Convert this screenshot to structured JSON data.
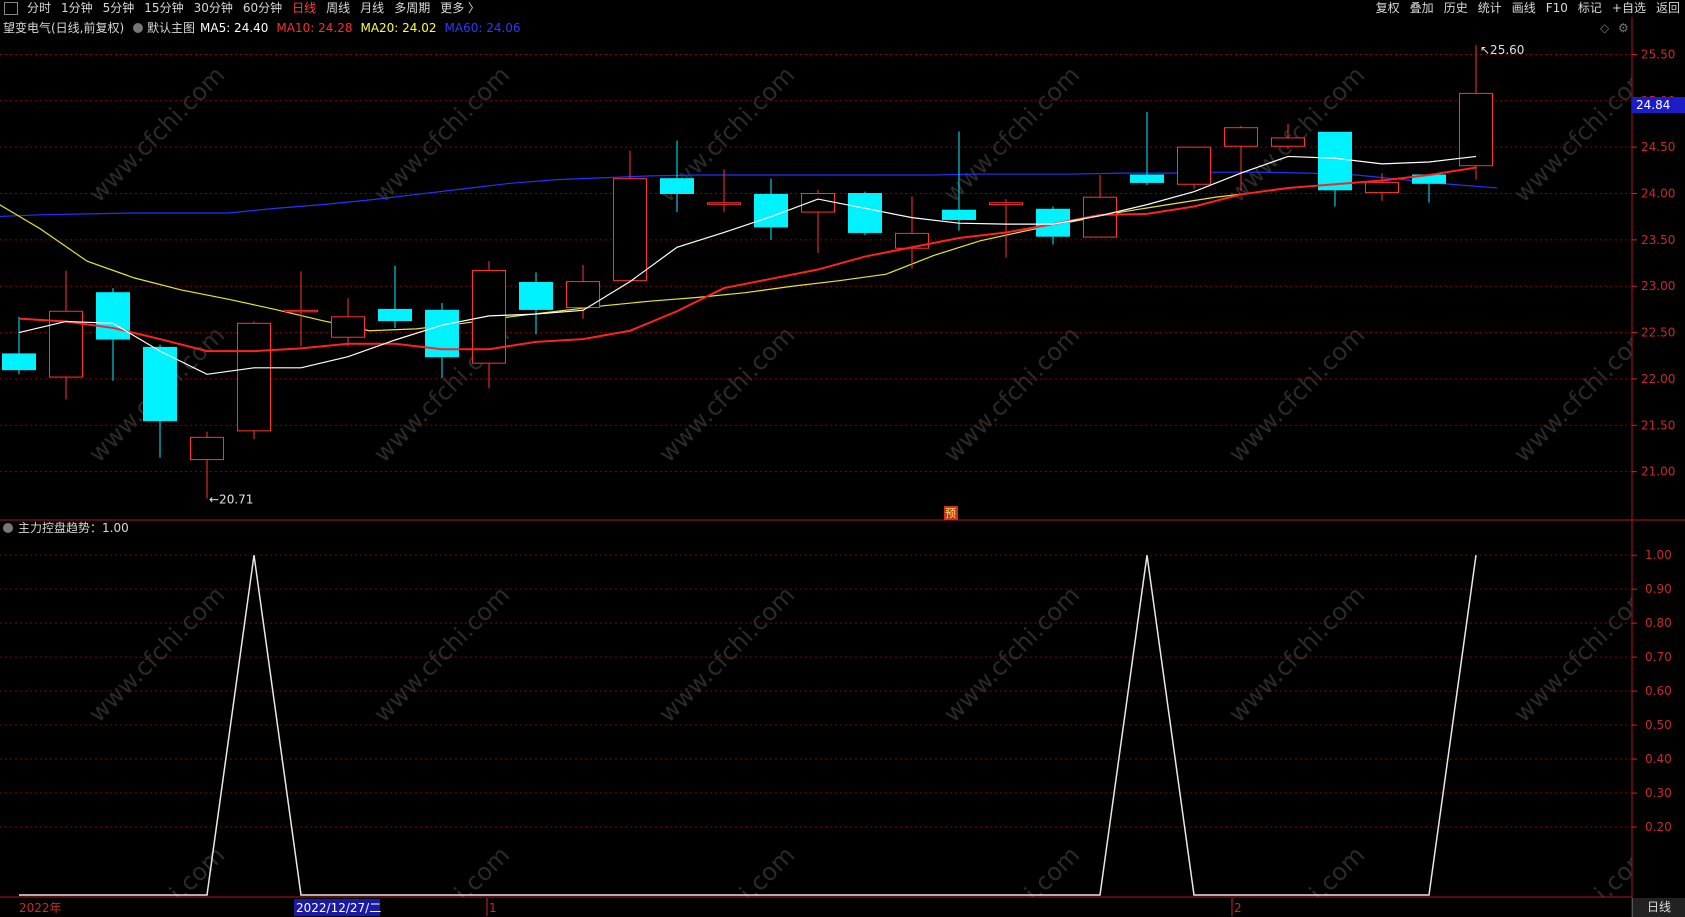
{
  "toolbar": {
    "left_items": [
      {
        "label": "分时",
        "active": false
      },
      {
        "label": "1分钟",
        "active": false
      },
      {
        "label": "5分钟",
        "active": false
      },
      {
        "label": "15分钟",
        "active": false
      },
      {
        "label": "30分钟",
        "active": false
      },
      {
        "label": "60分钟",
        "active": false
      },
      {
        "label": "日线",
        "active": true
      },
      {
        "label": "周线",
        "active": false
      },
      {
        "label": "月线",
        "active": false
      },
      {
        "label": "多周期",
        "active": false
      },
      {
        "label": "更多 〉",
        "active": false
      }
    ],
    "right_items": [
      "复权",
      "叠加",
      "历史",
      "统计",
      "画线",
      "F10",
      "标记",
      "+自选",
      "返回"
    ]
  },
  "main_legend": {
    "stock": "望变电气(日线,前复权)",
    "template": "默认主图",
    "ma": [
      {
        "label": "MA5: 24.40",
        "color": "#ffffff"
      },
      {
        "label": "MA10: 24.28",
        "color": "#ff2a2a"
      },
      {
        "label": "MA20: 24.02",
        "color": "#ffff33"
      },
      {
        "label": "MA60: 24.06",
        "color": "#2a3bff"
      }
    ]
  },
  "sub_legend": {
    "label": "主力控盘趋势：1.00"
  },
  "price_tag": "24.84",
  "period_label": "日线",
  "forecast_tag": "预",
  "date_axis": {
    "year": "2022年",
    "highlight": "2022/12/27/二",
    "m1": "1",
    "m2": "2"
  },
  "colors": {
    "up": "#ff3333",
    "down": "#00f2ff",
    "ma5": "#ffffff",
    "ma10": "#ff2222",
    "ma20": "#e6e62a",
    "ma60": "#2233ff",
    "grid": "#8b0000",
    "axis_text": "#c8282d"
  },
  "chart_data": [
    {
      "type": "candlestick",
      "title": "望变电气(日线,前复权)",
      "ylim": [
        20.5,
        25.85
      ],
      "yticks": [
        21.0,
        21.5,
        22.0,
        22.5,
        23.0,
        23.5,
        24.0,
        24.5,
        25.0,
        25.5
      ],
      "ytick_labels": [
        "21.00",
        "21.50",
        "22.00",
        "22.50",
        "23.00",
        "23.50",
        "24.00",
        "24.50",
        "25.00",
        "25.50"
      ],
      "candles": [
        {
          "o": 22.27,
          "c": 22.1,
          "h": 22.67,
          "l": 22.05
        },
        {
          "o": 22.02,
          "c": 22.73,
          "h": 23.17,
          "l": 21.78
        },
        {
          "o": 22.93,
          "c": 22.43,
          "h": 22.98,
          "l": 21.98
        },
        {
          "o": 22.34,
          "c": 21.55,
          "h": 22.37,
          "l": 21.15
        },
        {
          "o": 21.13,
          "c": 21.37,
          "h": 21.43,
          "l": 20.71
        },
        {
          "o": 21.44,
          "c": 22.6,
          "h": 22.62,
          "l": 21.35
        },
        {
          "o": 22.74,
          "c": 22.74,
          "h": 23.16,
          "l": 22.35
        },
        {
          "o": 22.45,
          "c": 22.67,
          "h": 22.87,
          "l": 22.35
        },
        {
          "o": 22.75,
          "c": 22.63,
          "h": 23.22,
          "l": 22.55
        },
        {
          "o": 22.74,
          "c": 22.24,
          "h": 22.82,
          "l": 22.01
        },
        {
          "o": 22.17,
          "c": 23.17,
          "h": 23.27,
          "l": 21.9
        },
        {
          "o": 23.04,
          "c": 22.75,
          "h": 23.15,
          "l": 22.48
        },
        {
          "o": 22.77,
          "c": 23.05,
          "h": 23.23,
          "l": 22.65
        },
        {
          "o": 23.06,
          "c": 24.16,
          "h": 24.46,
          "l": 23.05
        },
        {
          "o": 24.16,
          "c": 24.0,
          "h": 24.57,
          "l": 23.8
        },
        {
          "o": 23.9,
          "c": 23.9,
          "h": 24.26,
          "l": 23.8
        },
        {
          "o": 23.99,
          "c": 23.64,
          "h": 24.16,
          "l": 23.5
        },
        {
          "o": 23.8,
          "c": 24.0,
          "h": 24.04,
          "l": 23.36
        },
        {
          "o": 24.0,
          "c": 23.58,
          "h": 24.02,
          "l": 23.55
        },
        {
          "o": 23.41,
          "c": 23.57,
          "h": 23.97,
          "l": 23.19
        },
        {
          "o": 23.82,
          "c": 23.72,
          "h": 24.67,
          "l": 23.6
        },
        {
          "o": 23.88,
          "c": 23.9,
          "h": 23.94,
          "l": 23.31
        },
        {
          "o": 23.83,
          "c": 23.54,
          "h": 23.86,
          "l": 23.45
        },
        {
          "o": 23.53,
          "c": 23.96,
          "h": 24.2,
          "l": 23.53
        },
        {
          "o": 24.2,
          "c": 24.12,
          "h": 24.88,
          "l": 24.09
        },
        {
          "o": 24.1,
          "c": 24.5,
          "h": 24.5,
          "l": 24.05
        },
        {
          "o": 24.51,
          "c": 24.71,
          "h": 24.73,
          "l": 24.03
        },
        {
          "o": 24.51,
          "c": 24.6,
          "h": 24.75,
          "l": 24.48
        },
        {
          "o": 24.66,
          "c": 24.04,
          "h": 24.66,
          "l": 23.86
        },
        {
          "o": 24.01,
          "c": 24.12,
          "h": 24.22,
          "l": 23.92
        },
        {
          "o": 24.2,
          "c": 24.11,
          "h": 24.2,
          "l": 23.9
        },
        {
          "o": 24.3,
          "c": 25.08,
          "h": 25.6,
          "l": 24.15
        }
      ],
      "ma5": [
        22.5,
        22.62,
        22.6,
        22.3,
        22.05,
        22.12,
        22.12,
        22.24,
        22.42,
        22.58,
        22.68,
        22.7,
        22.74,
        23.05,
        23.42,
        23.58,
        23.75,
        23.94,
        23.84,
        23.74,
        23.68,
        23.67,
        23.67,
        23.76,
        23.88,
        24.02,
        24.22,
        24.4,
        24.38,
        24.32,
        24.34,
        24.4
      ],
      "ma10": [
        22.65,
        22.62,
        22.55,
        22.43,
        22.3,
        22.3,
        22.33,
        22.38,
        22.38,
        22.32,
        22.32,
        22.4,
        22.43,
        22.52,
        22.73,
        22.98,
        23.08,
        23.18,
        23.32,
        23.42,
        23.52,
        23.58,
        23.67,
        23.77,
        23.78,
        23.86,
        23.99,
        24.06,
        24.1,
        24.14,
        24.2,
        24.28
      ],
      "ma20": [
        23.92,
        23.62,
        23.27,
        23.09,
        22.96,
        22.86,
        22.75,
        22.63,
        22.52,
        22.54,
        22.6,
        22.67,
        22.73,
        22.79,
        22.84,
        22.88,
        22.93,
        23.0,
        23.06,
        23.13,
        23.33,
        23.49,
        23.6,
        23.7,
        23.8,
        23.88,
        23.96,
        24.02
      ],
      "ma60": [
        23.75,
        23.77,
        23.78,
        23.79,
        23.79,
        23.79,
        23.84,
        23.88,
        23.93,
        23.99,
        24.05,
        24.11,
        24.15,
        24.17,
        24.19,
        24.2,
        24.2,
        24.2,
        24.2,
        24.2,
        24.2,
        24.21,
        24.21,
        24.21,
        24.22,
        24.22,
        24.23,
        24.23,
        24.22,
        24.2,
        24.15,
        24.1,
        24.06
      ],
      "high_label": "25.60",
      "low_label": "20.71"
    },
    {
      "type": "line",
      "title": "主力控盘趋势",
      "ylim": [
        0,
        1.08
      ],
      "yticks": [
        0.2,
        0.3,
        0.4,
        0.5,
        0.6,
        0.7,
        0.8,
        0.9,
        1.0
      ],
      "ytick_labels": [
        "0.20",
        "0.30",
        "0.40",
        "0.50",
        "0.60",
        "0.70",
        "0.80",
        "0.90",
        "1.00"
      ],
      "values": [
        0,
        0,
        0,
        0,
        0,
        1,
        0,
        0,
        0,
        0,
        0,
        0,
        0,
        0,
        0,
        0,
        0,
        0,
        0,
        0,
        0,
        0,
        0,
        0,
        1,
        0,
        0,
        0,
        0,
        0,
        0,
        1
      ]
    }
  ]
}
